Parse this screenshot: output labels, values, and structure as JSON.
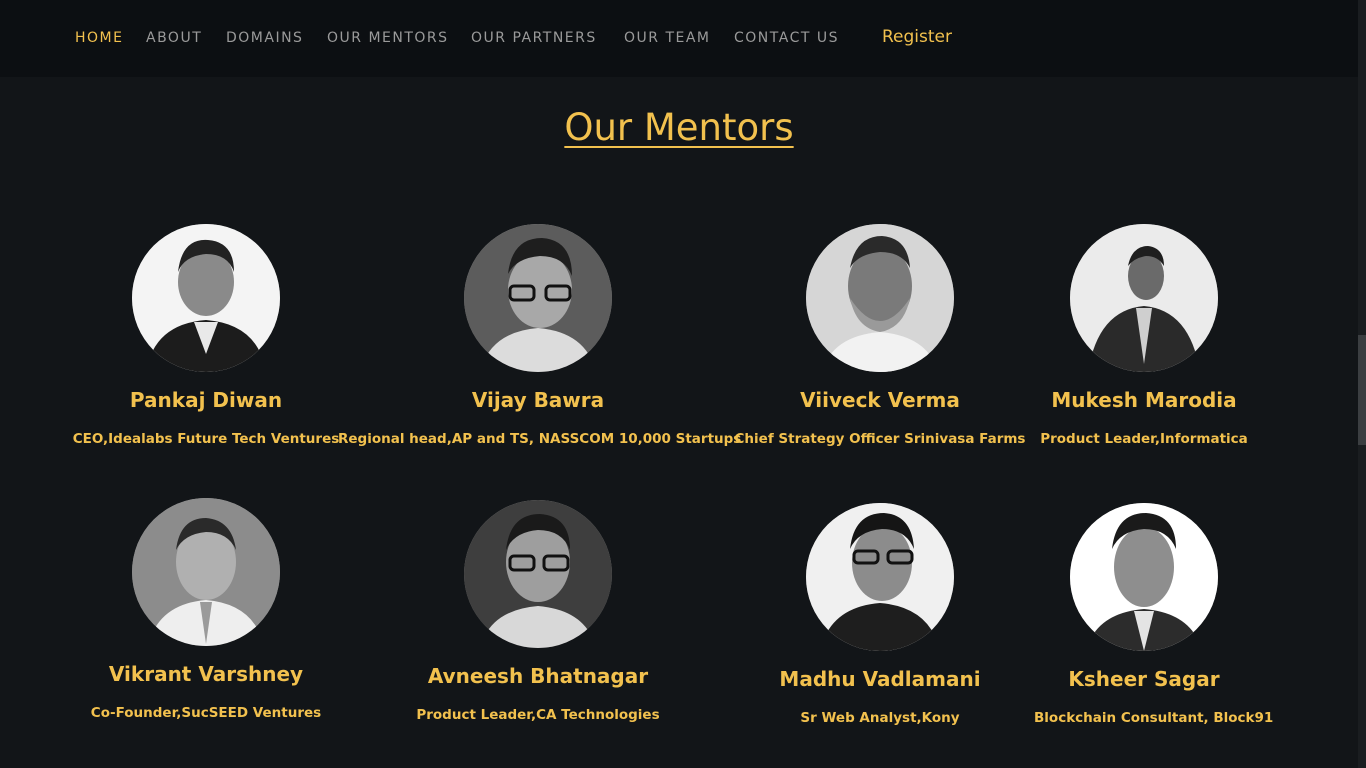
{
  "nav": {
    "items": [
      {
        "label": "HOME",
        "active": true
      },
      {
        "label": "ABOUT",
        "active": false
      },
      {
        "label": "DOMAINS",
        "active": false
      },
      {
        "label": "OUR MENTORS",
        "active": false
      },
      {
        "label": "OUR PARTNERS",
        "active": false
      },
      {
        "label": "OUR TEAM",
        "active": false
      },
      {
        "label": "CONTACT US",
        "active": false
      }
    ],
    "register_label": "Register"
  },
  "page": {
    "title": "Our Mentors"
  },
  "mentors": [
    {
      "name": "Pankaj Diwan",
      "role": "CEO,Idealabs Future Tech Ventures"
    },
    {
      "name": "Vijay Bawra",
      "role": "Regional head,AP and TS, NASSCOM 10,000 Startups"
    },
    {
      "name": "Viiveck Verma",
      "role": "Chief Strategy Officer Srinivasa Farms"
    },
    {
      "name": "Mukesh Marodia",
      "role": "Product Leader,Informatica"
    },
    {
      "name": "Vikrant Varshney",
      "role": "Co-Founder,SucSEED Ventures"
    },
    {
      "name": "Avneesh Bhatnagar",
      "role": "Product Leader,CA Technologies"
    },
    {
      "name": "Madhu Vadlamani",
      "role": "Sr Web Analyst,Kony"
    },
    {
      "name": "Ksheer Sagar",
      "role": "Blockchain Consultant, Block91"
    }
  ],
  "theme": {
    "accent": "#f2c14e",
    "background": "#121518",
    "nav_background": "#0c0f12",
    "nav_text": "#9a9a9a"
  }
}
